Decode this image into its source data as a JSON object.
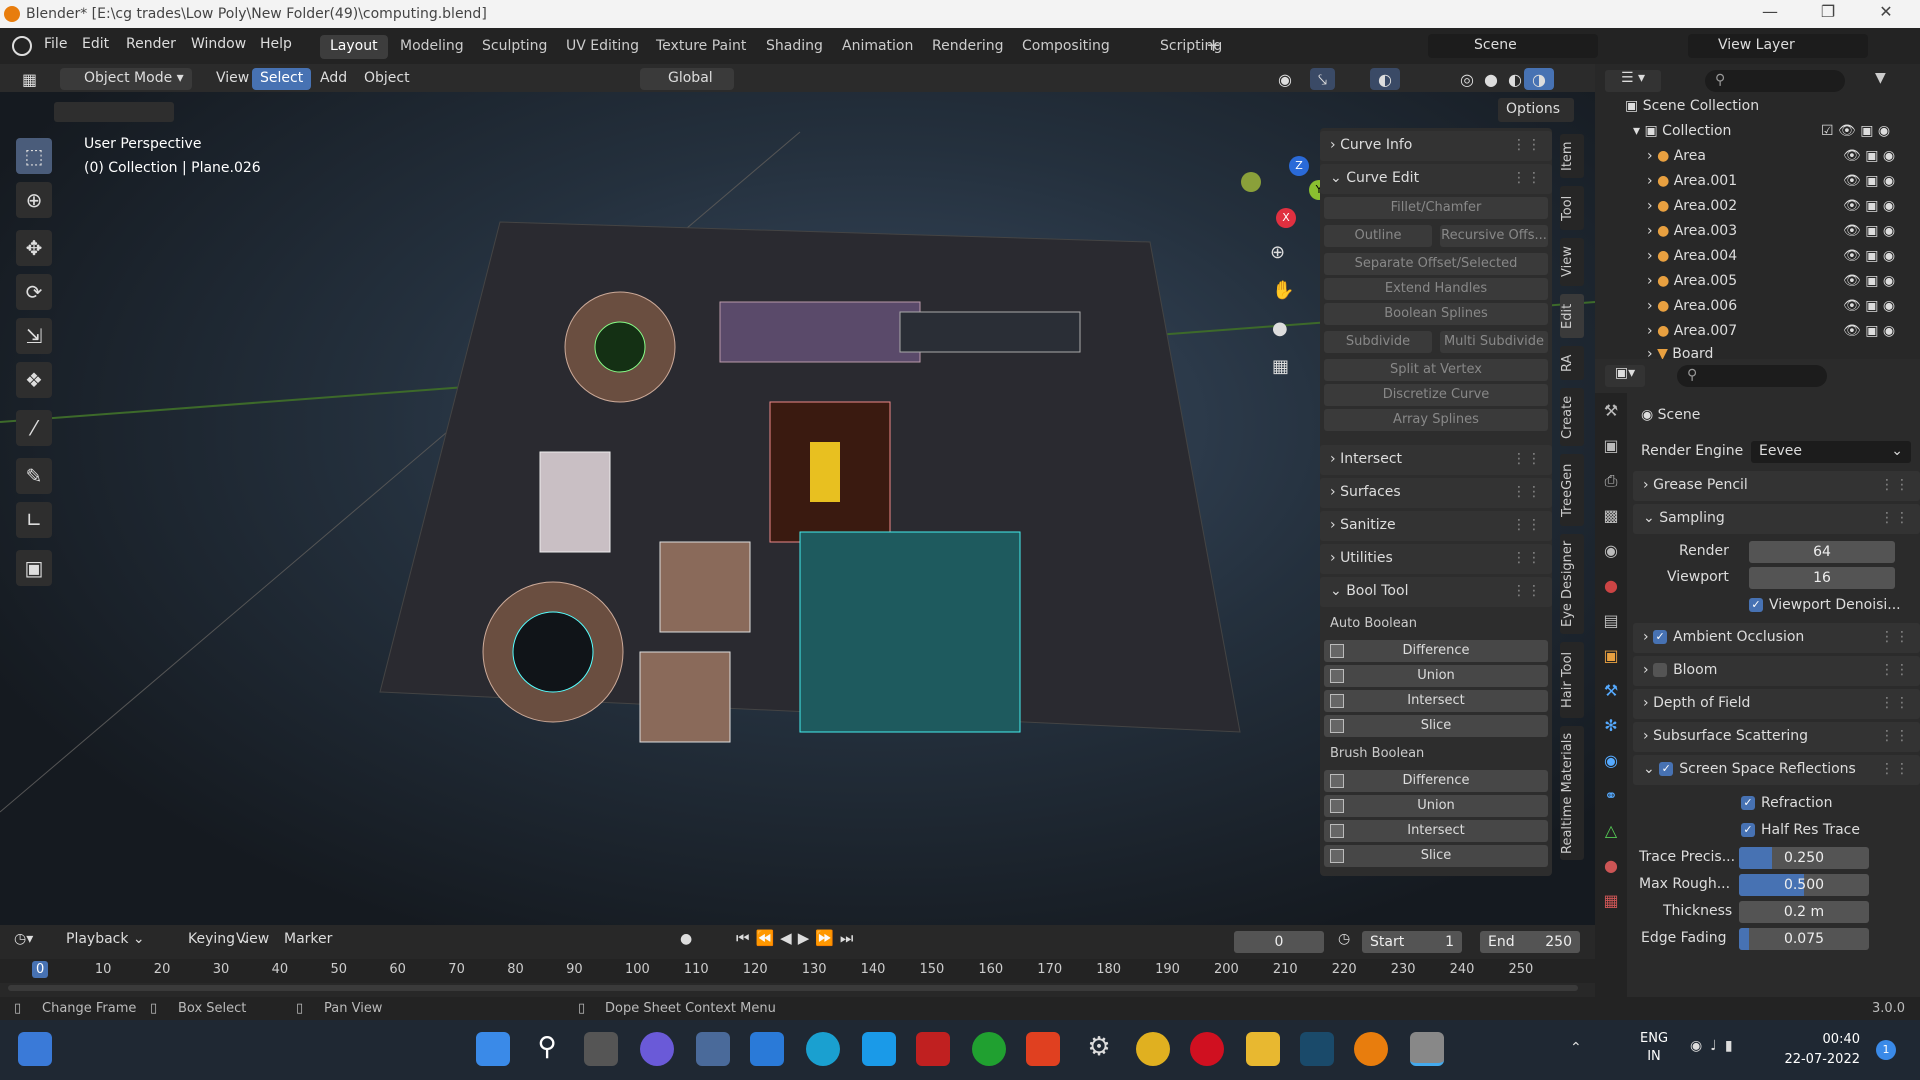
{
  "window": {
    "title": "Blender* [E:\\cg trades\\Low Poly\\New Folder(49)\\computing.blend]"
  },
  "menu": [
    "File",
    "Edit",
    "Render",
    "Window",
    "Help"
  ],
  "workspaces": [
    "Layout",
    "Modeling",
    "Sculpting",
    "UV Editing",
    "Texture Paint",
    "Shading",
    "Animation",
    "Rendering",
    "Compositing",
    "Scripting",
    "+"
  ],
  "scene": {
    "label": "Scene",
    "view_layer": "View Layer"
  },
  "header": {
    "mode": "Object Mode",
    "view": "View",
    "select": "Select",
    "add": "Add",
    "object": "Object",
    "transform": "Global",
    "options": "Options"
  },
  "viewport": {
    "line1": "User Perspective",
    "line2": "(0) Collection | Plane.026"
  },
  "gizmo": {
    "x": "X",
    "y": "Y",
    "z": "Z"
  },
  "npanel": {
    "curve_info": "Curve Info",
    "curve_edit": "Curve Edit",
    "buttons": [
      "Fillet/Chamfer",
      "Outline",
      "Recursive Offs...",
      "Separate Offset/Selected",
      "Extend Handles",
      "Boolean Splines",
      "Subdivide",
      "Multi Subdivide",
      "Split at Vertex",
      "Discretize Curve",
      "Array Splines"
    ],
    "collapsed": [
      "Intersect",
      "Surfaces",
      "Sanitize",
      "Utilities"
    ],
    "bool_tool": "Bool Tool",
    "auto_boolean": "Auto Boolean",
    "brush_boolean": "Brush Boolean",
    "bool_ops": [
      "Difference",
      "Union",
      "Intersect",
      "Slice"
    ]
  },
  "vtabs": [
    "Item",
    "Tool",
    "View",
    "Edit",
    "RA",
    "Create",
    "TreeGen",
    "Eye Designer",
    "Hair Tool",
    "Realtime Materials"
  ],
  "outliner": {
    "root": "Scene Collection",
    "collection": "Collection",
    "items": [
      "Area",
      "Area.001",
      "Area.002",
      "Area.003",
      "Area.004",
      "Area.005",
      "Area.006",
      "Area.007",
      "Board"
    ]
  },
  "props": {
    "scene": "Scene",
    "engine_label": "Render Engine",
    "engine": "Eevee",
    "grease_pencil": "Grease Pencil",
    "sampling": "Sampling",
    "render_label": "Render",
    "render_val": "64",
    "viewport_label": "Viewport",
    "viewport_val": "16",
    "viewport_denoise": "Viewport Denoisi...",
    "ambient_occlusion": "Ambient Occlusion",
    "bloom": "Bloom",
    "depth_of_field": "Depth of Field",
    "subsurface": "Subsurface Scattering",
    "ssr": "Screen Space Reflections",
    "refraction": "Refraction",
    "half_res": "Half Res Trace",
    "trace_label": "Trace Precis...",
    "trace_val": "0.250",
    "trace_frac": 0.25,
    "rough_label": "Max Rough...",
    "rough_val": "0.500",
    "rough_frac": 0.5,
    "thick_label": "Thickness",
    "thick_val": "0.2 m",
    "edge_label": "Edge Fading",
    "edge_val": "0.075",
    "edge_frac": 0.075
  },
  "timeline": {
    "playback": "Playback",
    "keying": "Keying",
    "view": "View",
    "marker": "Marker",
    "frame": "0",
    "start_label": "Start",
    "start": "1",
    "end_label": "End",
    "end": "250",
    "ticks": [
      "0",
      "10",
      "20",
      "30",
      "40",
      "50",
      "60",
      "70",
      "80",
      "90",
      "100",
      "110",
      "120",
      "130",
      "140",
      "150",
      "160",
      "170",
      "180",
      "190",
      "200",
      "210",
      "220",
      "230",
      "240",
      "250"
    ]
  },
  "status": {
    "change_frame": "Change Frame",
    "box_select": "Box Select",
    "pan_view": "Pan View",
    "context_menu": "Dope Sheet Context Menu",
    "version": "3.0.0"
  },
  "taskbar": {
    "lang1": "ENG",
    "lang2": "IN",
    "time": "00:40",
    "date": "22-07-2022",
    "notif": "1"
  }
}
